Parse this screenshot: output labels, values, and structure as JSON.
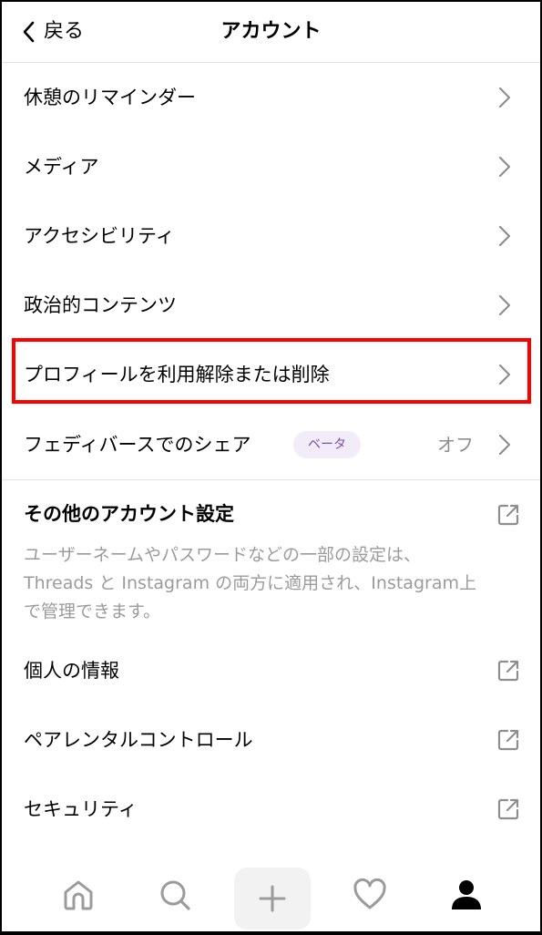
{
  "header": {
    "back_label": "戻る",
    "title": "アカウント"
  },
  "menu": {
    "items": [
      {
        "label": "休憩のリマインダー"
      },
      {
        "label": "メディア"
      },
      {
        "label": "アクセシビリティ"
      },
      {
        "label": "政治的コンテンツ"
      },
      {
        "label": "プロフィールを利用解除または削除"
      },
      {
        "label": "フェディバースでのシェア",
        "badge": "ベータ",
        "value": "オフ"
      }
    ]
  },
  "other_settings": {
    "title": "その他のアカウント設定",
    "description": "ユーザーネームやパスワードなどの一部の設定は、Threads と Instagram の両方に適用され、Instagram上で管理できます。",
    "items": [
      {
        "label": "個人の情報"
      },
      {
        "label": "ペアレンタルコントロール"
      },
      {
        "label": "セキュリティ"
      }
    ]
  },
  "tabbar": {
    "icons": [
      "home-icon",
      "search-icon",
      "plus-icon",
      "heart-icon",
      "profile-icon"
    ]
  },
  "colors": {
    "highlight": "#ff0000",
    "badge_bg": "#f1ecf8",
    "badge_text": "#7b4fa8",
    "secondary_text": "#8e8e8e"
  }
}
